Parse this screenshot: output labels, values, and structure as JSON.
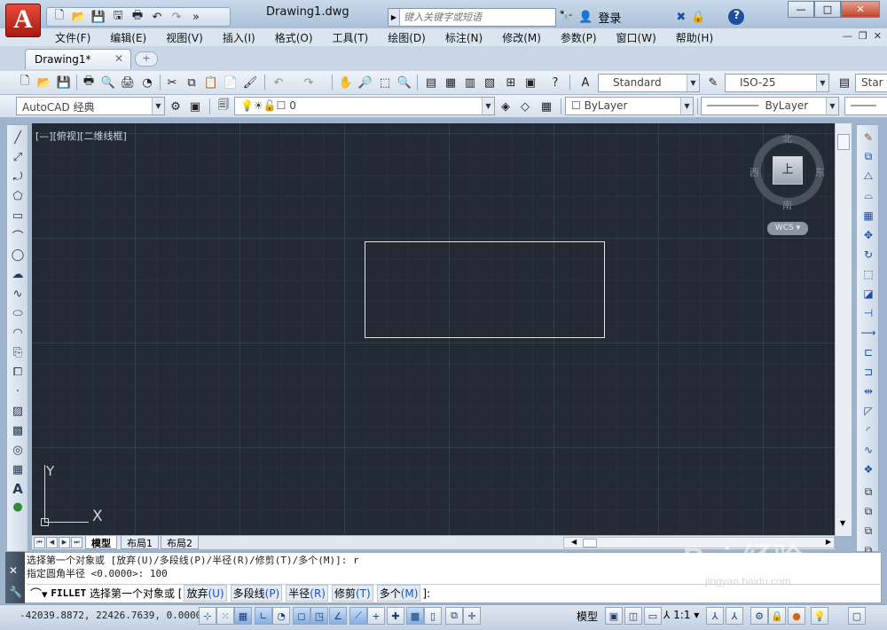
{
  "app": {
    "logo_letter": "A",
    "document_title": "Drawing1.dwg"
  },
  "quick_access": {
    "icons": [
      "new-icon",
      "open-icon",
      "save-icon",
      "save-as-icon",
      "print-icon",
      "undo-icon",
      "redo-icon",
      "more-icon"
    ]
  },
  "search": {
    "placeholder": "键入关键字或短语"
  },
  "title_right": {
    "login_label": "登录",
    "help_label": "?"
  },
  "window": {
    "minimize": "—",
    "maximize": "□",
    "close": "✕"
  },
  "menu": [
    "文件(F)",
    "编辑(E)",
    "视图(V)",
    "插入(I)",
    "格式(O)",
    "工具(T)",
    "绘图(D)",
    "标注(N)",
    "修改(M)",
    "参数(P)",
    "窗口(W)",
    "帮助(H)"
  ],
  "doc_tabs": [
    {
      "label": "Drawing1*"
    }
  ],
  "toolbar1": {
    "text_style": "Standard",
    "dim_style": "ISO-25",
    "table_style_partial": "Star"
  },
  "toolbar2": {
    "workspace": "AutoCAD 经典",
    "layer_name": "0",
    "color": "ByLayer",
    "linetype": "ByLayer"
  },
  "viewport": {
    "label": "[—][俯视][二维线框]"
  },
  "viewcube": {
    "north": "北",
    "south": "南",
    "east": "东",
    "west": "西",
    "face": "上",
    "wcs_label": "WCS"
  },
  "ucs": {
    "x_label": "X",
    "y_label": "Y"
  },
  "layout_tabs": [
    "模型",
    "布局1",
    "布局2"
  ],
  "command": {
    "history": [
      "选择第一个对象或 [放弃(U)/多段线(P)/半径(R)/修剪(T)/多个(M)]: r",
      "指定圆角半径 <0.0000>: 100"
    ],
    "prompt_command": "FILLET",
    "prompt_text": "选择第一个对象或",
    "options": [
      {
        "label": "放弃",
        "key": "(U)"
      },
      {
        "label": "多段线",
        "key": "(P)"
      },
      {
        "label": "半径",
        "key": "(R)"
      },
      {
        "label": "修剪",
        "key": "(T)"
      },
      {
        "label": "多个",
        "key": "(M)"
      }
    ],
    "prompt_end": "]:"
  },
  "status": {
    "coords": "-42039.8872, 22426.7639, 0.0000",
    "model_label": "模型",
    "scale": "1:1"
  },
  "watermark": {
    "brand": "Bai 经验",
    "url": "jingyan.baidu.com"
  }
}
